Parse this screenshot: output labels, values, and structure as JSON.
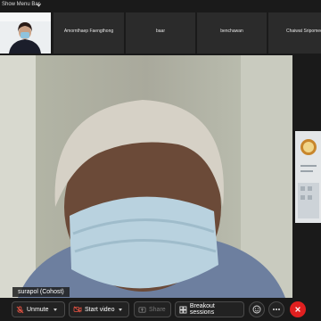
{
  "menu_bar": {
    "label": "Show Menu Bar",
    "icon": "chevron-down-icon"
  },
  "participants": [
    {
      "name": ""
    },
    {
      "name": "Amornthaep Faengthong"
    },
    {
      "name": "baar"
    },
    {
      "name": "benchawan"
    },
    {
      "name": "Chaiwat Sripomee"
    }
  ],
  "main_speaker": {
    "name": "surapol (Cohost)"
  },
  "toolbar": {
    "mic_label": "Unmute",
    "video_label": "Start video",
    "share_label": "Share",
    "breakout_label": "Breakout sessions"
  },
  "colors": {
    "end_button": "#e02020",
    "accent": "#ffffff"
  }
}
